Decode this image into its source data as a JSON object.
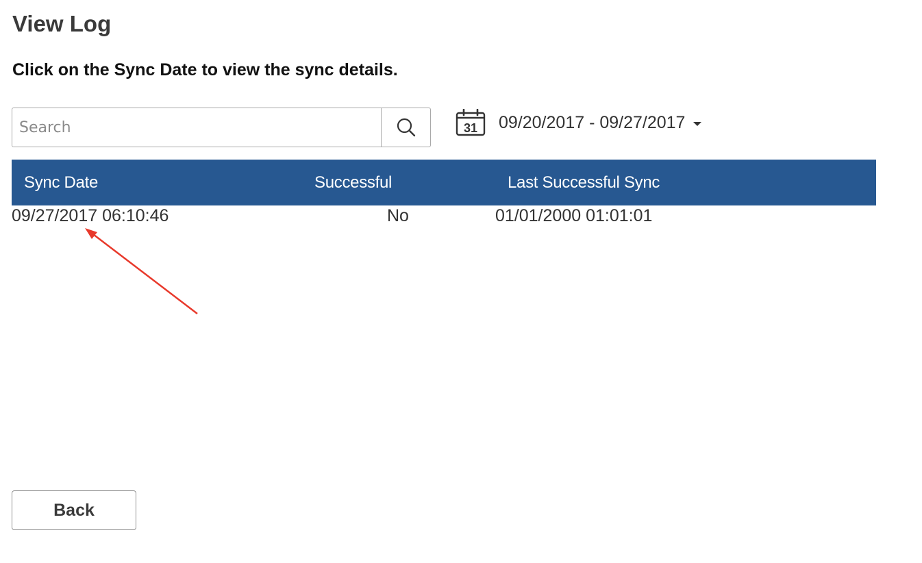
{
  "page": {
    "title": "View Log",
    "instructions": "Click on the Sync Date to view the sync details."
  },
  "search": {
    "placeholder": "Search",
    "value": "",
    "button_icon": "search-icon"
  },
  "date_filter": {
    "icon": "calendar-icon",
    "calendar_day": "31",
    "range_label": "09/20/2017 - 09/27/2017",
    "dropdown_icon": "caret-down-icon"
  },
  "table": {
    "header_color": "#275891",
    "columns": [
      "Sync Date",
      "Successful",
      "Last Successful Sync"
    ],
    "rows": [
      {
        "sync_date": "09/27/2017 06:10:46",
        "successful": "No",
        "last_successful_sync": "01/01/2000 01:01:01"
      }
    ]
  },
  "annotation": {
    "type": "arrow",
    "color": "#e8392b"
  },
  "footer": {
    "back_label": "Back"
  }
}
